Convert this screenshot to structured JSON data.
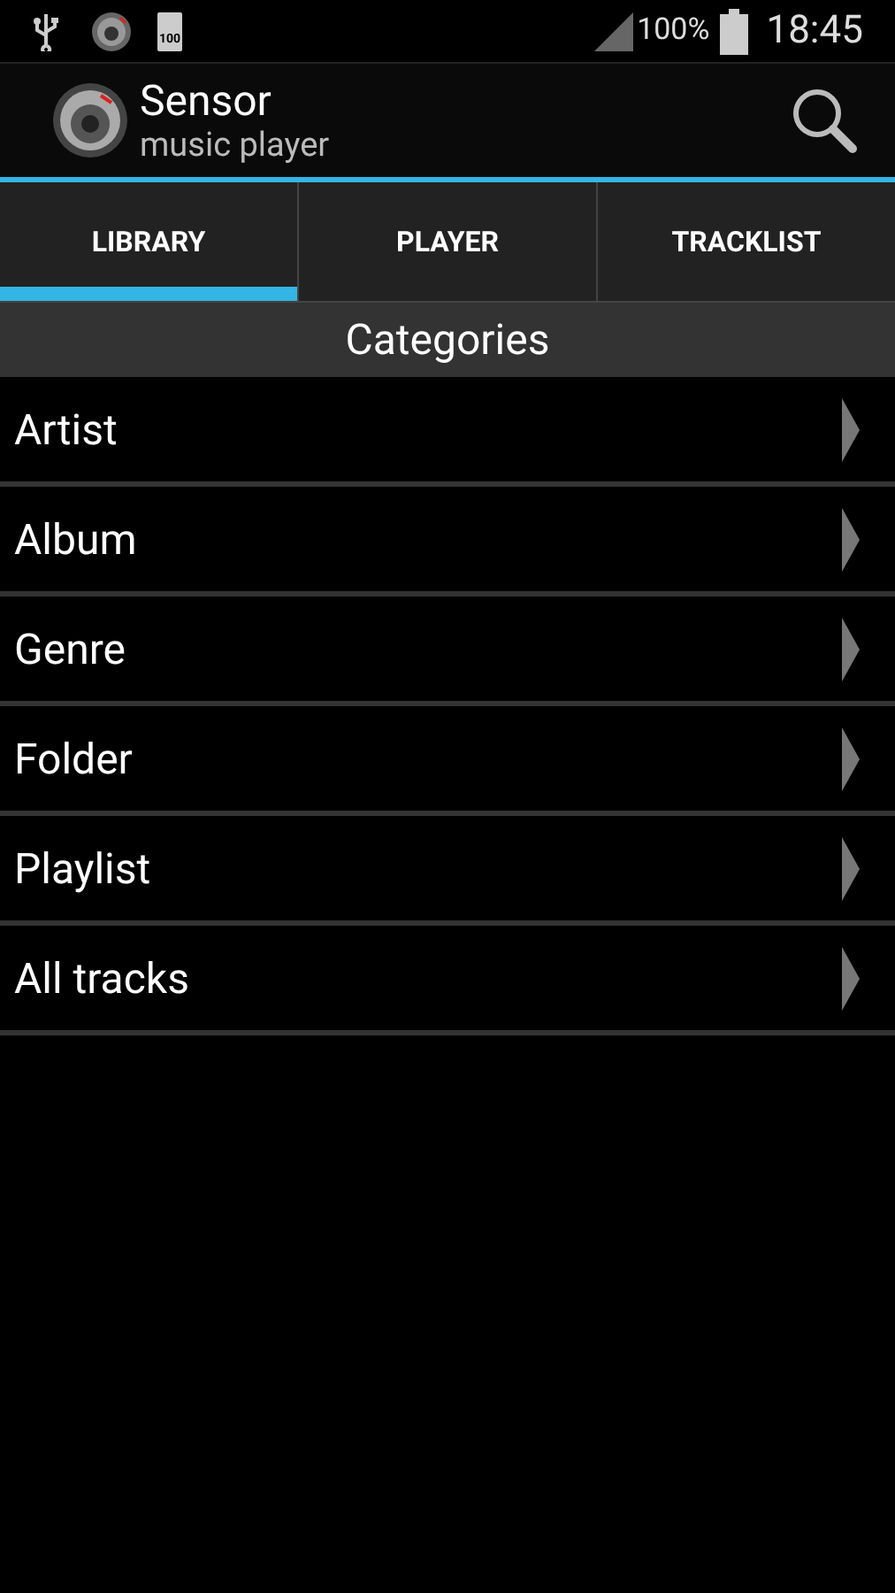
{
  "status_bar": {
    "notification_battery": "100",
    "battery_percent": "100%",
    "time": "18:45"
  },
  "action_bar": {
    "title": "Sensor",
    "subtitle": "music player"
  },
  "tabs": [
    {
      "label": "LIBRARY",
      "selected": true
    },
    {
      "label": "PLAYER",
      "selected": false
    },
    {
      "label": "TRACKLIST",
      "selected": false
    }
  ],
  "section_header": "Categories",
  "categories": [
    {
      "label": "Artist"
    },
    {
      "label": "Album"
    },
    {
      "label": "Genre"
    },
    {
      "label": "Folder"
    },
    {
      "label": "Playlist"
    },
    {
      "label": "All tracks"
    }
  ]
}
